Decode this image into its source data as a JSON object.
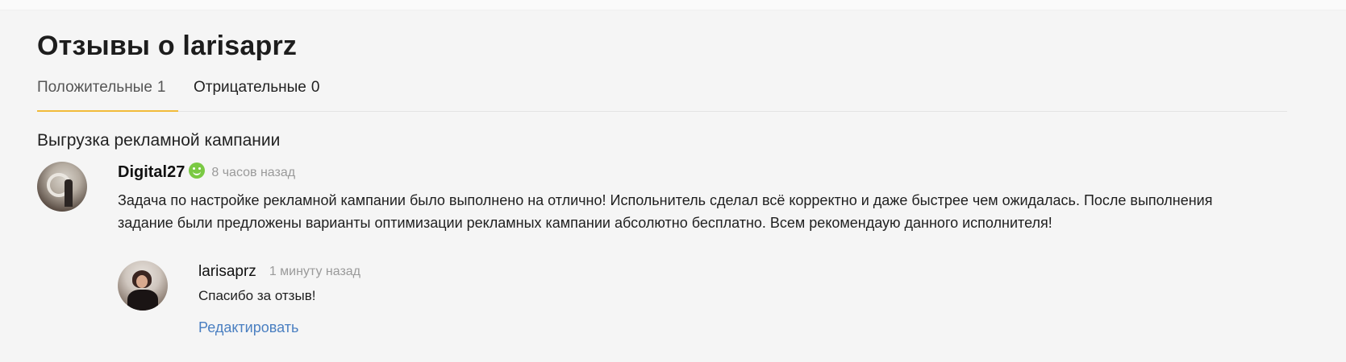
{
  "page": {
    "title": "Отзывы о larisaprz"
  },
  "tabs": [
    {
      "label": "Положительные",
      "count": "1",
      "active": true
    },
    {
      "label": "Отрицательные",
      "count": "0",
      "active": false
    }
  ],
  "review": {
    "project_title": "Выгрузка рекламной кампании",
    "author": "Digital27",
    "author_icon": "smile-icon",
    "time": "8 часов назад",
    "text": "Задача по настройке рекламной кампании было выполнено на отлично! Испольнитель сделал всё корректно и даже быстрее чем ожидалась. После выполнения задание были предложены варианты оптимизации рекламных кампании абсолютно бесплатно. Всем рекомендаую данного исполнителя!",
    "reply": {
      "author": "larisaprz",
      "time": "1 минуту назад",
      "text": "Спасибо за отзыв!",
      "edit_label": "Редактировать"
    }
  },
  "colors": {
    "background": "#f5f5f5",
    "active_tab_underline": "#f1bb3a",
    "positive_badge": "#7ac943",
    "link": "#4a7fc1",
    "muted_text": "#9a9a9a"
  }
}
